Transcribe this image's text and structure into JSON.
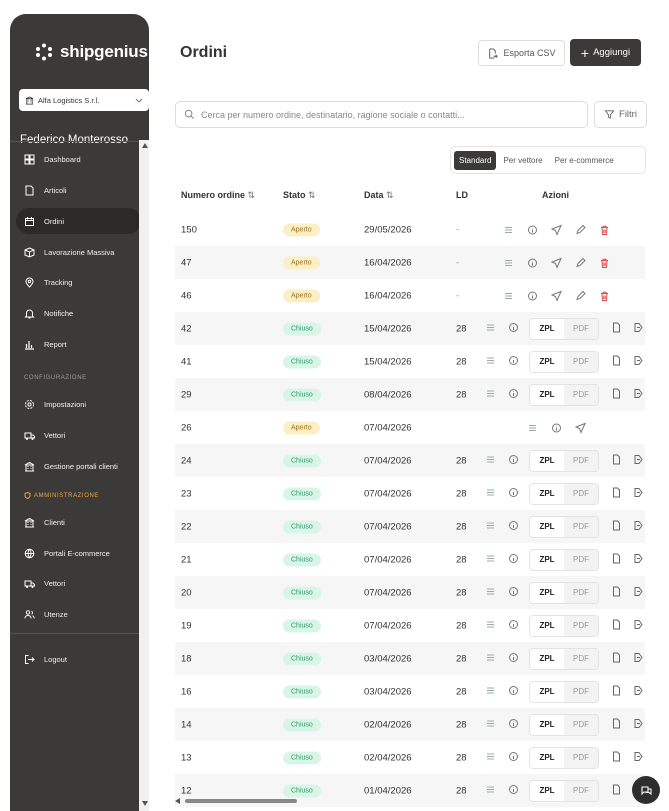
{
  "sidebar": {
    "logo_text": "shipgenius",
    "company_select": "Alfa Logistics S.r.l.",
    "user_name": "Federico Monterosso",
    "items": [
      {
        "label": "Dashboard",
        "icon": "dashboard-icon"
      },
      {
        "label": "Articoli",
        "icon": "file-icon"
      },
      {
        "label": "Ordini",
        "icon": "calendar-icon",
        "active": true
      },
      {
        "label": "Lavorazione Massiva",
        "icon": "box-icon"
      },
      {
        "label": "Tracking",
        "icon": "pin-icon"
      },
      {
        "label": "Notifiche",
        "icon": "bell-icon"
      },
      {
        "label": "Report",
        "icon": "chart-icon"
      }
    ],
    "section_config": "CONFIGURAZIONE",
    "config_items": [
      {
        "label": "Impostazioni",
        "icon": "gear-icon"
      },
      {
        "label": "Vettori",
        "icon": "truck-icon"
      },
      {
        "label": "Gestione portali clienti",
        "icon": "building-icon"
      }
    ],
    "section_admin": "AMMINISTRAZIONE",
    "admin_items": [
      {
        "label": "Clienti",
        "icon": "building-icon"
      },
      {
        "label": "Portali E-commerce",
        "icon": "globe-icon"
      },
      {
        "label": "Vettori",
        "icon": "truck-icon"
      },
      {
        "label": "Utenze",
        "icon": "users-icon"
      }
    ],
    "logout": "Logout"
  },
  "header": {
    "title": "Ordini",
    "export_label": "Esporta CSV",
    "add_label": "Aggiungi"
  },
  "search": {
    "placeholder": "Cerca per numero ordine, destinatario, ragione sociale o contatti...",
    "filter_label": "Filtri"
  },
  "view_toggle": [
    "Standard",
    "Per vettore",
    "Per e-commerce"
  ],
  "table": {
    "headers": {
      "num": "Numero ordine",
      "stato": "Stato",
      "data": "Data",
      "ld": "LD",
      "azioni": "Azioni"
    },
    "zpl": "ZPL",
    "pdf": "PDF",
    "rows": [
      {
        "num": "150",
        "stato": "Aperto",
        "data": "29/05/2026",
        "ld": "-"
      },
      {
        "num": "47",
        "stato": "Aperto",
        "data": "16/04/2026",
        "ld": "-"
      },
      {
        "num": "46",
        "stato": "Aperto",
        "data": "16/04/2026",
        "ld": "-"
      },
      {
        "num": "42",
        "stato": "Chiuso",
        "data": "15/04/2026",
        "ld": "28"
      },
      {
        "num": "41",
        "stato": "Chiuso",
        "data": "15/04/2026",
        "ld": "28"
      },
      {
        "num": "29",
        "stato": "Chiuso",
        "data": "08/04/2026",
        "ld": "28"
      },
      {
        "num": "26",
        "stato": "Aperto",
        "data": "07/04/2026",
        "ld": ""
      },
      {
        "num": "24",
        "stato": "Chiuso",
        "data": "07/04/2026",
        "ld": "28"
      },
      {
        "num": "23",
        "stato": "Chiuso",
        "data": "07/04/2026",
        "ld": "28"
      },
      {
        "num": "22",
        "stato": "Chiuso",
        "data": "07/04/2026",
        "ld": "28"
      },
      {
        "num": "21",
        "stato": "Chiuso",
        "data": "07/04/2026",
        "ld": "28"
      },
      {
        "num": "20",
        "stato": "Chiuso",
        "data": "07/04/2026",
        "ld": "28"
      },
      {
        "num": "19",
        "stato": "Chiuso",
        "data": "07/04/2026",
        "ld": "28"
      },
      {
        "num": "18",
        "stato": "Chiuso",
        "data": "03/04/2026",
        "ld": "28"
      },
      {
        "num": "16",
        "stato": "Chiuso",
        "data": "03/04/2026",
        "ld": "28"
      },
      {
        "num": "14",
        "stato": "Chiuso",
        "data": "02/04/2026",
        "ld": "28"
      },
      {
        "num": "13",
        "stato": "Chiuso",
        "data": "02/04/2026",
        "ld": "28"
      },
      {
        "num": "12",
        "stato": "Chiuso",
        "data": "01/04/2026",
        "ld": "28"
      }
    ]
  }
}
